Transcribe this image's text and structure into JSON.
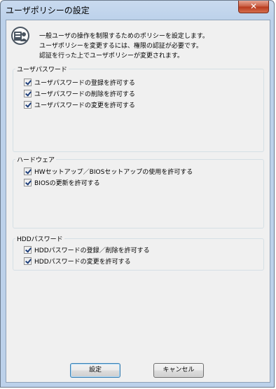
{
  "window": {
    "title": "ユーザポリシーの設定",
    "close_label": "✕"
  },
  "description": {
    "lines": [
      "一般ユーザの操作を制限するためのポリシーを設定します。",
      "ユーザポリシーを変更するには、権限の認証が必要です。",
      "認証を行った上でユーザポリシーが変更されます。"
    ]
  },
  "groups": [
    {
      "label": "ユーザパスワード",
      "items": [
        "ユーザパスワードの登録を許可する",
        "ユーザパスワードの削除を許可する",
        "ユーザパスワードの変更を許可する"
      ],
      "checked": [
        true,
        true,
        true
      ]
    },
    {
      "label": "ハードウェア",
      "items": [
        "HWセットアップ／BIOSセットアップの使用を許可する",
        "BIOSの更新を許可する"
      ],
      "checked": [
        true,
        true
      ]
    },
    {
      "label": "HDDパスワード",
      "items": [
        "HDDパスワードの登録／削除を許可する",
        "HDDパスワードの変更を許可する"
      ],
      "checked": [
        true,
        true
      ]
    }
  ],
  "buttons": {
    "ok": "設定",
    "cancel": "キャンセル"
  },
  "icon": "user-policy-icon"
}
